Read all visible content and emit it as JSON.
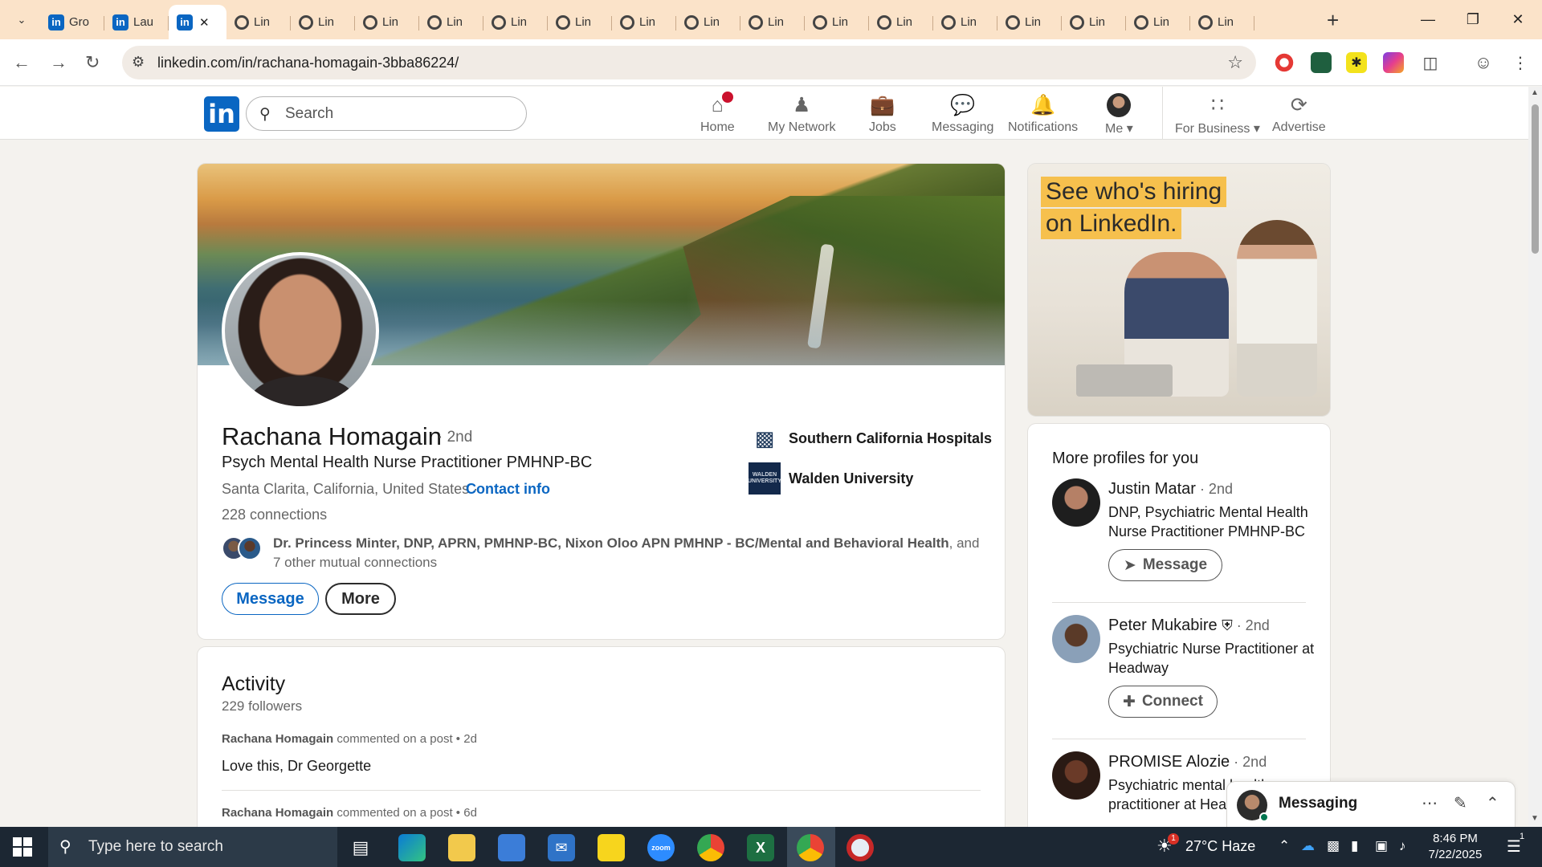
{
  "browser": {
    "tabs": [
      {
        "label": "Gro",
        "icon": "linkedin-icon"
      },
      {
        "label": "Lau",
        "icon": "linkedin-icon"
      },
      {
        "label": "",
        "icon": "linkedin-icon",
        "active": true
      },
      {
        "label": "Lin",
        "icon": "loading-icon"
      },
      {
        "label": "Lin",
        "icon": "loading-icon"
      },
      {
        "label": "Lin",
        "icon": "loading-icon"
      },
      {
        "label": "Lin",
        "icon": "loading-icon"
      },
      {
        "label": "Lin",
        "icon": "loading-icon"
      },
      {
        "label": "Lin",
        "icon": "loading-icon"
      },
      {
        "label": "Lin",
        "icon": "loading-icon"
      },
      {
        "label": "Lin",
        "icon": "loading-icon"
      },
      {
        "label": "Lin",
        "icon": "loading-icon"
      },
      {
        "label": "Lin",
        "icon": "loading-icon"
      },
      {
        "label": "Lin",
        "icon": "loading-icon"
      },
      {
        "label": "Lin",
        "icon": "loading-icon"
      },
      {
        "label": "Lin",
        "icon": "loading-icon"
      },
      {
        "label": "Lin",
        "icon": "loading-icon"
      },
      {
        "label": "Lin",
        "icon": "loading-icon"
      },
      {
        "label": "Lin",
        "icon": "loading-icon"
      },
      {
        "label": "Lin",
        "icon": "loading-icon"
      }
    ],
    "url": "linkedin.com/in/rachana-homagain-3bba86224/"
  },
  "linkedin": {
    "logo": "in",
    "search_placeholder": "Search",
    "nav": {
      "home": "Home",
      "network": "My Network",
      "jobs": "Jobs",
      "messaging": "Messaging",
      "notifications": "Notifications",
      "me": "Me",
      "business": "For Business",
      "advertise": "Advertise"
    }
  },
  "profile": {
    "name": "Rachana Homagain",
    "degree": "· 2nd",
    "headline": "Psych Mental Health Nurse Practitioner PMHNP-BC",
    "location": "Santa Clarita, California, United States ·",
    "contact": "Contact info",
    "connections": "228 connections",
    "mutual_names": "Dr. Princess Minter, DNP, APRN, PMHNP-BC, Nixon Oloo APN PMHNP - BC/Mental and Behavioral Health",
    "mutual_rest": ", and 7 other mutual connections",
    "message_btn": "Message",
    "more_btn": "More",
    "org1": "Southern California Hospitals",
    "org2": "Walden University",
    "org2_logo": "WALDEN UNIVERSITY"
  },
  "activity": {
    "title": "Activity",
    "followers": "229 followers",
    "post1_author": "Rachana Homagain",
    "post1_meta": " commented on a post • 2d",
    "post1_text": "Love this, Dr Georgette",
    "post2_author": "Rachana Homagain",
    "post2_meta": " commented on a post • 6d"
  },
  "ad": {
    "line1": "See who's hiring",
    "line2": "on LinkedIn."
  },
  "more_profiles": {
    "title": "More profiles for you",
    "people": [
      {
        "name": "Justin Matar",
        "degree": " · 2nd",
        "headline": "DNP, Psychiatric Mental Health Nurse Practitioner PMHNP-BC",
        "action": "Message"
      },
      {
        "name": "Peter Mukabire",
        "degree": " · 2nd",
        "headline": "Psychiatric Nurse Practitioner at Headway",
        "action": "Connect"
      },
      {
        "name": "PROMISE Alozie",
        "degree": " · 2nd",
        "headline": "Psychiatric mental health nurse practitioner at Headway"
      }
    ]
  },
  "messaging": {
    "label": "Messaging"
  },
  "taskbar": {
    "search_placeholder": "Type here to search",
    "weather": "27°C Haze",
    "weather_badge": "1",
    "time": "8:46 PM",
    "date": "7/22/2025",
    "notif_count": "1"
  },
  "colors": {
    "linkedin_blue": "#0a66c2",
    "chrome_tabbar": "#fbe3c9",
    "taskbar": "#1c2733"
  }
}
